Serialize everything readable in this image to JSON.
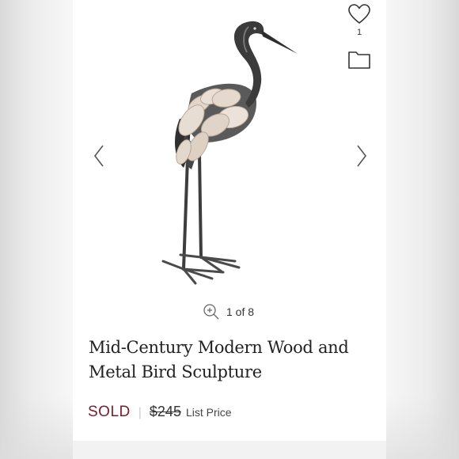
{
  "product": {
    "title_line1": "Mid-Century Modern Wood and",
    "title_line2": "Metal Bird Sculpture",
    "status": "SOLD",
    "original_price": "$245",
    "price_label": "List Price"
  },
  "actions": {
    "like_count": "1",
    "like_icon": "heart-outline-icon",
    "folder_icon": "folder-icon"
  },
  "gallery": {
    "counter": "1 of 8",
    "zoom_icon": "zoom-in-icon",
    "prev_icon": "chevron-left-icon",
    "next_icon": "chevron-right-icon"
  },
  "colors": {
    "sold": "#7a1d2a",
    "text": "#222222"
  }
}
